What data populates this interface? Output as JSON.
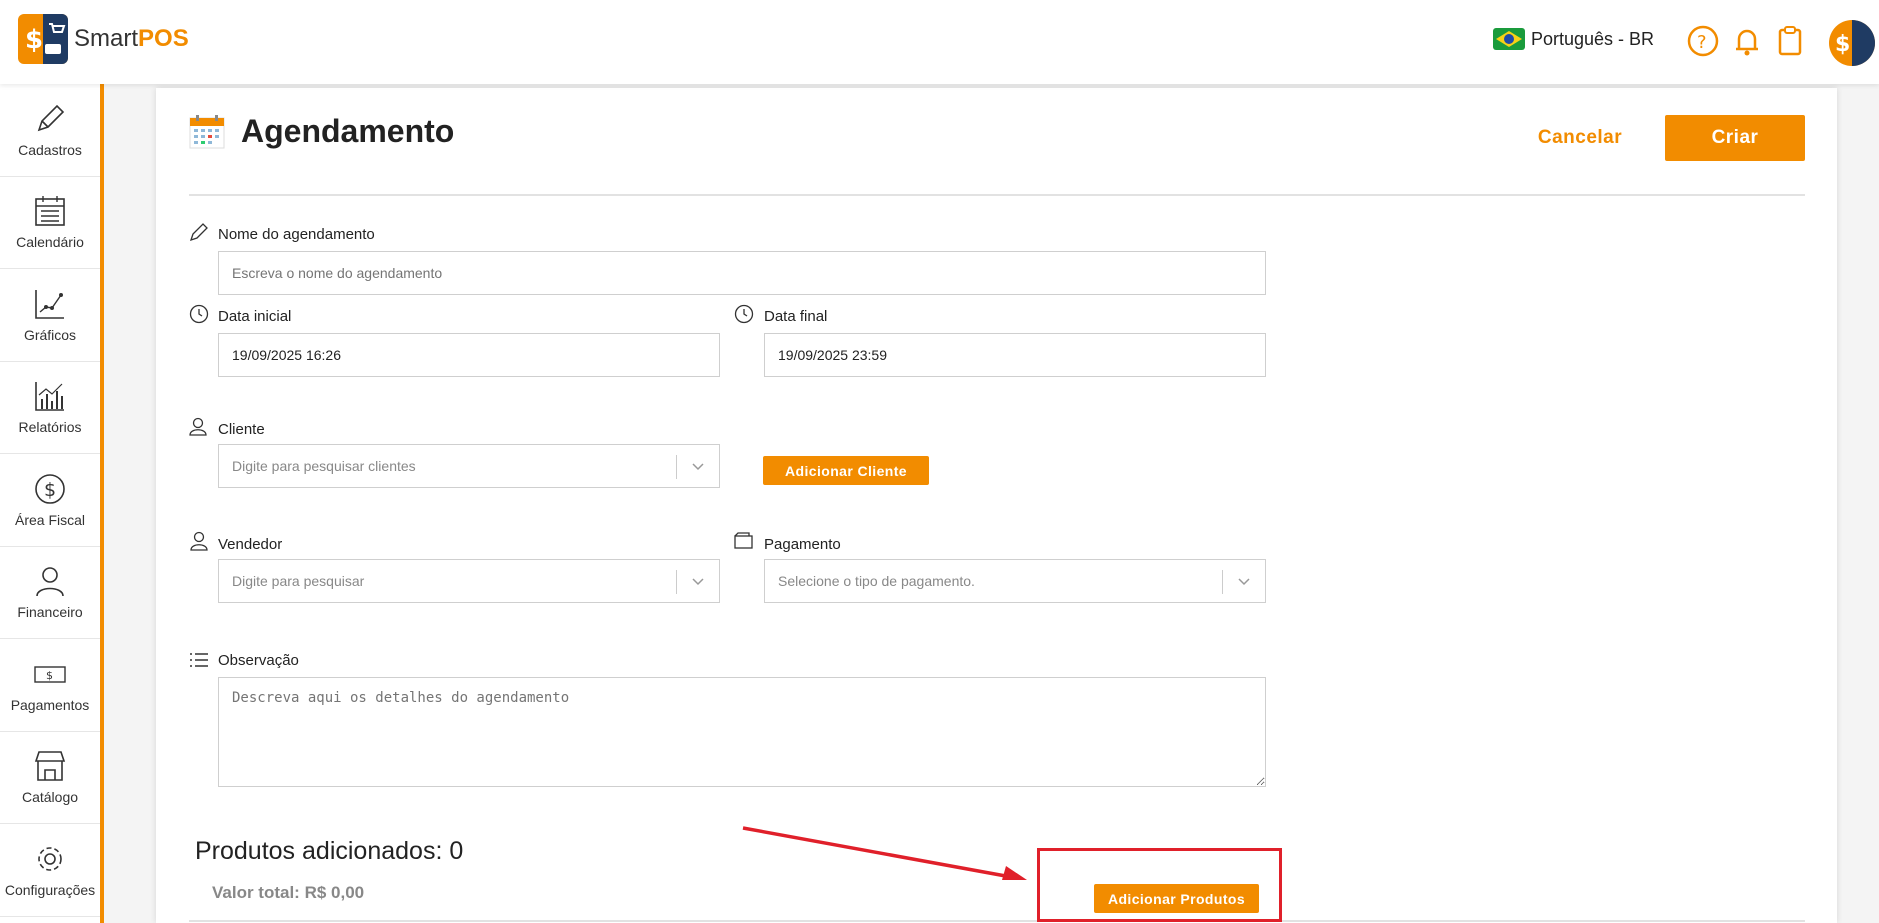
{
  "brand": {
    "name_regular": "Smart",
    "name_bold": "POS"
  },
  "header": {
    "language": "Português - BR"
  },
  "sidebar": {
    "items": [
      {
        "label": "Cadastros",
        "icon": "pencil-icon"
      },
      {
        "label": "Calendário",
        "icon": "calendar-icon"
      },
      {
        "label": "Gráficos",
        "icon": "line-chart-icon"
      },
      {
        "label": "Relatórios",
        "icon": "bar-chart-icon"
      },
      {
        "label": "Área Fiscal",
        "icon": "dollar-circle-icon"
      },
      {
        "label": "Financeiro",
        "icon": "person-icon"
      },
      {
        "label": "Pagamentos",
        "icon": "banknote-icon"
      },
      {
        "label": "Catálogo",
        "icon": "store-icon"
      },
      {
        "label": "Configurações",
        "icon": "gear-icon"
      }
    ]
  },
  "page": {
    "title": "Agendamento",
    "cancel_label": "Cancelar",
    "create_label": "Criar"
  },
  "form": {
    "name": {
      "label": "Nome do agendamento",
      "placeholder": "Escreva o nome do agendamento"
    },
    "start": {
      "label": "Data inicial",
      "value": "19/09/2025 16:26"
    },
    "end": {
      "label": "Data final",
      "value": "19/09/2025 23:59"
    },
    "client": {
      "label": "Cliente",
      "placeholder": "Digite para pesquisar clientes",
      "add_label": "Adicionar Cliente"
    },
    "seller": {
      "label": "Vendedor",
      "placeholder": "Digite para pesquisar"
    },
    "payment": {
      "label": "Pagamento",
      "placeholder": "Selecione o tipo de pagamento."
    },
    "notes": {
      "label": "Observação",
      "placeholder": "Descreva aqui os detalhes do agendamento"
    }
  },
  "products": {
    "title": "Produtos adicionados: 0",
    "total": "Valor total: R$ 0,00",
    "add_label": "Adicionar Produtos"
  },
  "colors": {
    "accent": "#f28c00",
    "annotation": "#e0202a"
  }
}
